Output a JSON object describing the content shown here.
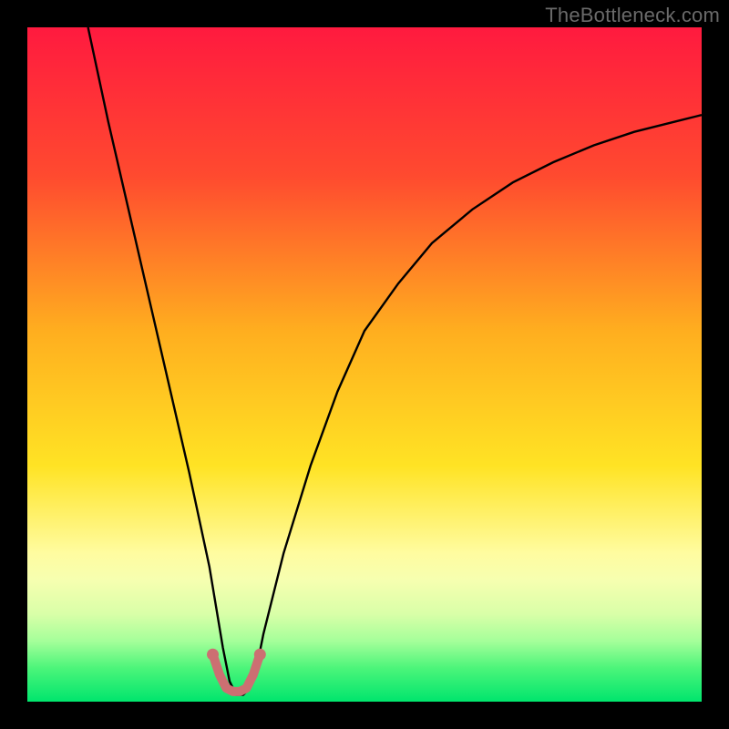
{
  "attribution": "TheBottleneck.com",
  "chart_data": {
    "type": "line",
    "title": "",
    "xlabel": "",
    "ylabel": "",
    "xlim": [
      0,
      100
    ],
    "ylim": [
      0,
      100
    ],
    "grid": false,
    "legend": false,
    "background_gradient_stops": [
      {
        "offset": 0.0,
        "color": "#ff1a3f"
      },
      {
        "offset": 0.22,
        "color": "#ff4a2f"
      },
      {
        "offset": 0.45,
        "color": "#ffae1f"
      },
      {
        "offset": 0.65,
        "color": "#ffe324"
      },
      {
        "offset": 0.78,
        "color": "#fffca0"
      },
      {
        "offset": 0.82,
        "color": "#f6ffb0"
      },
      {
        "offset": 0.87,
        "color": "#d9ffa8"
      },
      {
        "offset": 0.91,
        "color": "#a5ff9a"
      },
      {
        "offset": 0.95,
        "color": "#4cf57a"
      },
      {
        "offset": 1.0,
        "color": "#00e56d"
      }
    ],
    "series": [
      {
        "name": "bottleneck-curve",
        "color": "#000000",
        "x": [
          9,
          12,
          15,
          18,
          21,
          24,
          27,
          28,
          29,
          30,
          31,
          32,
          33,
          34,
          35,
          38,
          42,
          46,
          50,
          55,
          60,
          66,
          72,
          78,
          84,
          90,
          96,
          100
        ],
        "y": [
          100,
          86,
          73,
          60,
          47,
          34,
          20,
          14,
          8,
          3,
          1,
          1,
          2,
          5,
          10,
          22,
          35,
          46,
          55,
          62,
          68,
          73,
          77,
          80,
          82.5,
          84.5,
          86,
          87
        ]
      }
    ],
    "floor_arc": {
      "color": "#cc6f72",
      "stroke_width": 10,
      "points_x": [
        27.5,
        28.5,
        29.5,
        30.5,
        31.5,
        32.5,
        33.5,
        34.5
      ],
      "points_y": [
        7,
        4,
        2,
        1.5,
        1.5,
        2,
        4,
        7
      ],
      "end_dots": [
        {
          "x": 27.5,
          "y": 7
        },
        {
          "x": 34.5,
          "y": 7
        }
      ]
    }
  }
}
